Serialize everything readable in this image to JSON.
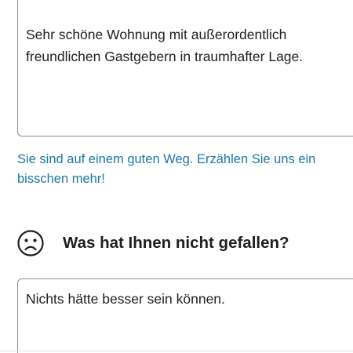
{
  "positive_review": {
    "text": "Sehr schöne Wohnung mit außerordentlich\nfreundlichen Gastgebern in traumhafter Lage."
  },
  "hint": {
    "text": "Sie sind auf einem guten Weg. Erzählen Sie uns ein bisschen mehr!",
    "color": "#1b79a6"
  },
  "negative_section": {
    "icon": "sad-face-icon",
    "title": "Was hat Ihnen nicht gefallen?"
  },
  "negative_review": {
    "text": "Nichts hätte besser sein können."
  }
}
